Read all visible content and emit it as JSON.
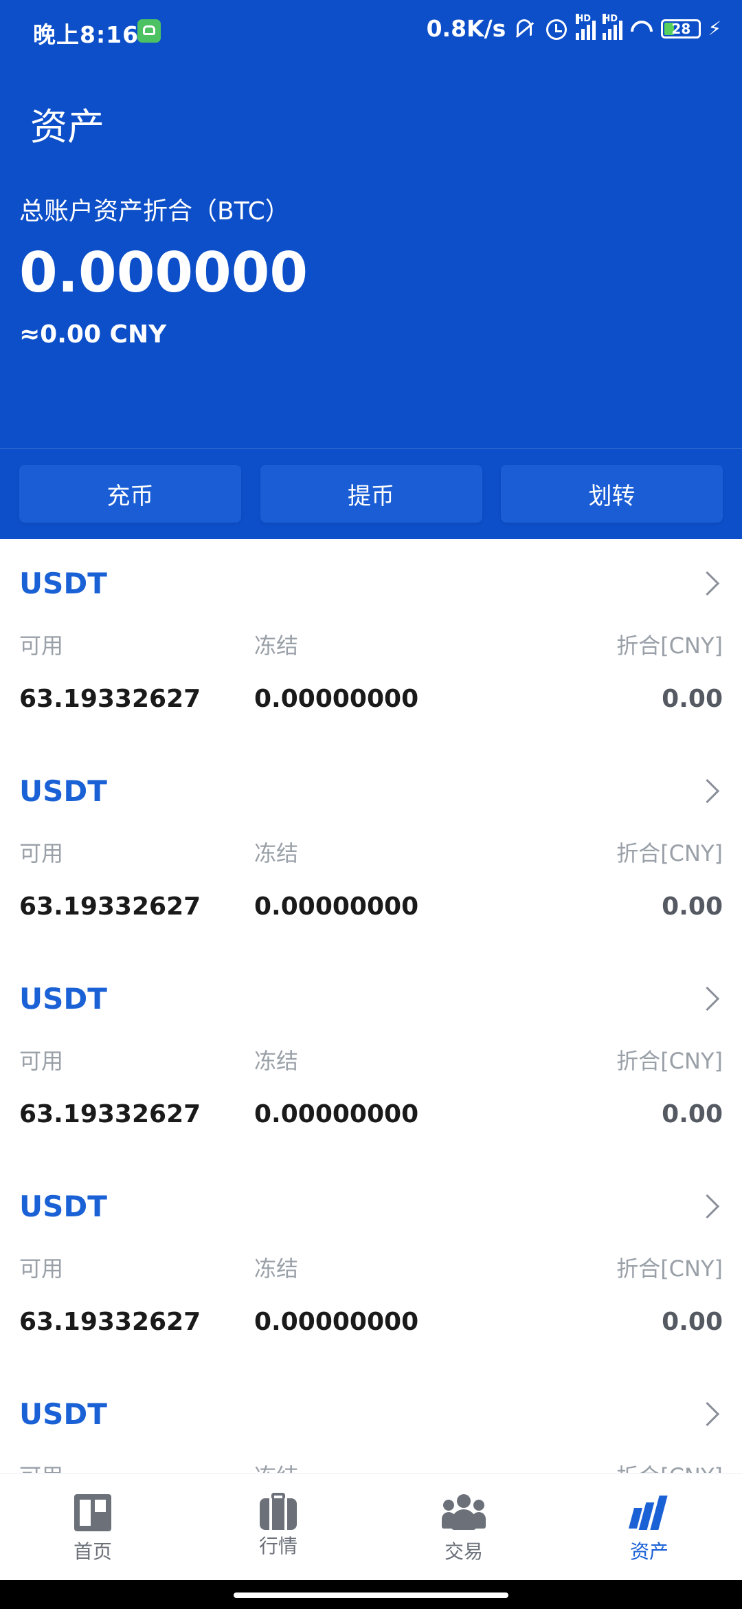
{
  "status_bar": {
    "time": "晚上8:16",
    "network_speed": "0.8K/s",
    "signal_1_label": "HD",
    "signal_2_label": "HD",
    "battery": "28",
    "icons": [
      "app-notification-icon",
      "mute-bell-icon",
      "alarm-icon",
      "signal-icon",
      "signal-icon",
      "wifi-icon",
      "battery-icon",
      "charging-icon"
    ]
  },
  "header": {
    "title": "资产",
    "total_label": "总账户资产折合（BTC）",
    "total_value": "0.000000",
    "total_cny": "≈0.00 CNY",
    "color": "#0d4fc9"
  },
  "actions": {
    "deposit": "充币",
    "withdraw": "提币",
    "transfer": "划转"
  },
  "assets": [
    {
      "name": "USDT",
      "avail_label": "可用",
      "frozen_label": "冻结",
      "cny_label": "折合[CNY]",
      "avail": "63.19332627",
      "frozen": "0.00000000",
      "cny": "0.00"
    },
    {
      "name": "USDT",
      "avail_label": "可用",
      "frozen_label": "冻结",
      "cny_label": "折合[CNY]",
      "avail": "63.19332627",
      "frozen": "0.00000000",
      "cny": "0.00"
    },
    {
      "name": "USDT",
      "avail_label": "可用",
      "frozen_label": "冻结",
      "cny_label": "折合[CNY]",
      "avail": "63.19332627",
      "frozen": "0.00000000",
      "cny": "0.00"
    },
    {
      "name": "USDT",
      "avail_label": "可用",
      "frozen_label": "冻结",
      "cny_label": "折合[CNY]",
      "avail": "63.19332627",
      "frozen": "0.00000000",
      "cny": "0.00"
    },
    {
      "name": "USDT",
      "avail_label": "可用",
      "frozen_label": "冻结",
      "cny_label": "折合[CNY]",
      "avail": "",
      "frozen": "",
      "cny": ""
    }
  ],
  "tabbar": {
    "home": "首页",
    "market": "行情",
    "trade": "交易",
    "assets": "资产",
    "active": "assets",
    "active_color": "#1b61d6"
  }
}
